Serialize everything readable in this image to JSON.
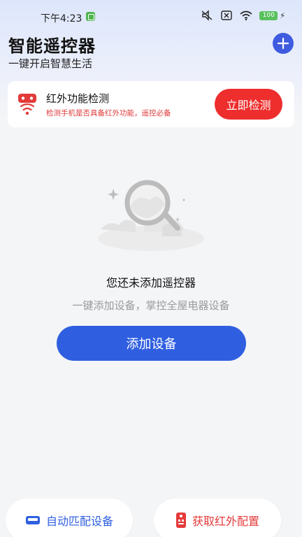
{
  "status_bar": {
    "time": "下午4:23",
    "battery": "100",
    "icons": [
      "mute-icon",
      "screenshot-icon",
      "wifi-icon",
      "battery-icon",
      "charging-icon"
    ]
  },
  "header": {
    "title": "智能遥控器",
    "subtitle": "一键开启智慧生活",
    "add_icon": "plus-icon"
  },
  "ir_card": {
    "title": "红外功能检测",
    "description": "检测手机是否具备红外功能，遥控必备",
    "button_label": "立即检测",
    "icon": "infrared-remote-icon"
  },
  "empty_state": {
    "illustration": "empty-search-illustration",
    "title": "您还未添加遥控器",
    "subtitle": "一键添加设备，掌控全屋电器设备",
    "button_label": "添加设备"
  },
  "bottom_actions": {
    "auto_match_label": "自动匹配设备",
    "auto_match_icon": "device-icon",
    "get_ir_label": "获取红外配置",
    "get_ir_icon": "remote-control-icon"
  },
  "colors": {
    "primary_blue": "#2f5fe0",
    "accent_red": "#ee2d2d",
    "fab_blue": "#3f5ce0",
    "background": "#f4f5f7"
  }
}
